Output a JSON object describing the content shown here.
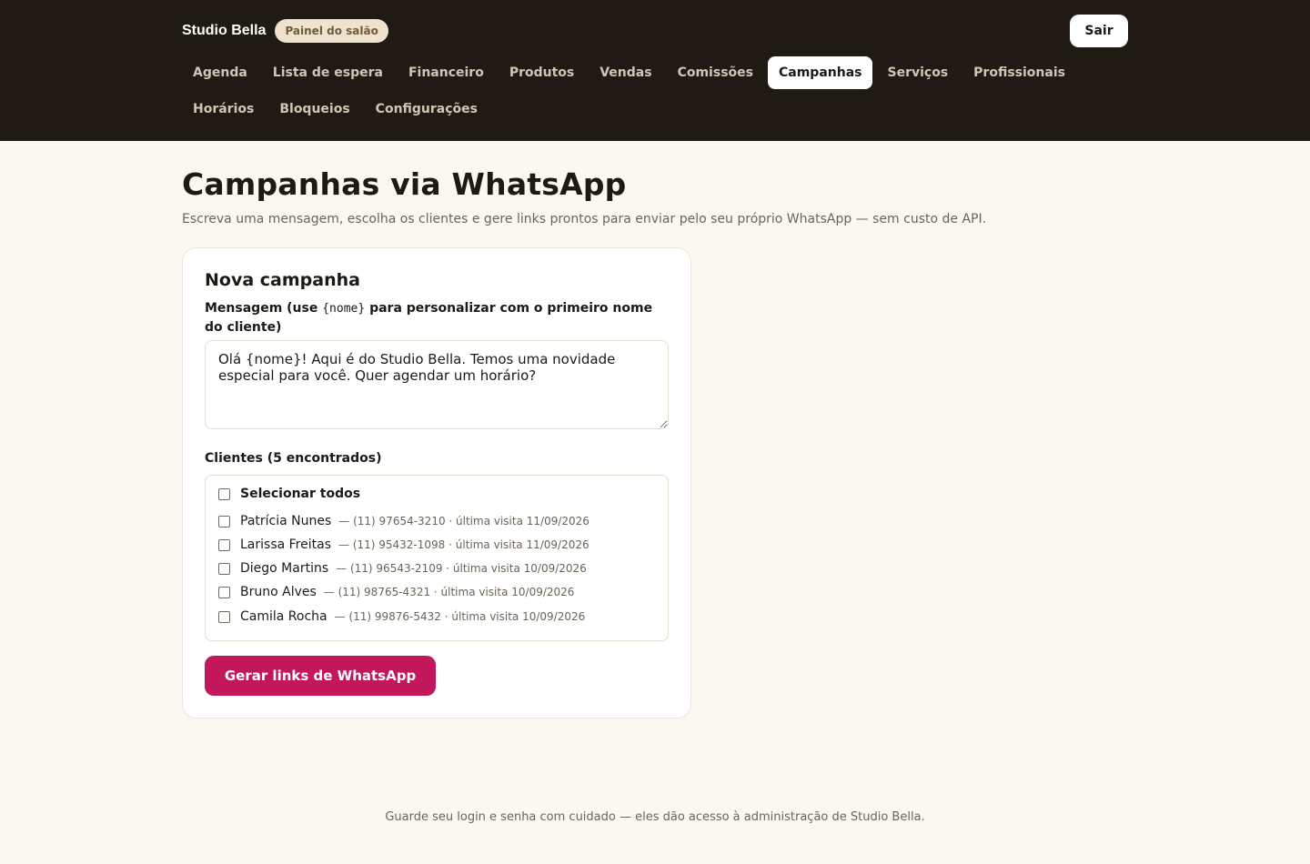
{
  "header": {
    "brand": "Studio Bella",
    "badge": "Painel do salão",
    "logout_label": "Sair",
    "nav": [
      {
        "label": "Agenda",
        "active": false
      },
      {
        "label": "Lista de espera",
        "active": false
      },
      {
        "label": "Financeiro",
        "active": false
      },
      {
        "label": "Produtos",
        "active": false
      },
      {
        "label": "Vendas",
        "active": false
      },
      {
        "label": "Comissões",
        "active": false
      },
      {
        "label": "Campanhas",
        "active": true
      },
      {
        "label": "Serviços",
        "active": false
      },
      {
        "label": "Profissionais",
        "active": false
      },
      {
        "label": "Horários",
        "active": false
      },
      {
        "label": "Bloqueios",
        "active": false
      },
      {
        "label": "Configurações",
        "active": false
      }
    ]
  },
  "main": {
    "title": "Campanhas via WhatsApp",
    "subtitle": "Escreva uma mensagem, escolha os clientes e gere links prontos para enviar pelo seu próprio WhatsApp — sem custo de API.",
    "card": {
      "title": "Nova campanha",
      "message_label_before": "Mensagem (use ",
      "message_label_code": "{nome}",
      "message_label_after": " para personalizar com o primeiro nome do cliente)",
      "message_value": "Olá {nome}! Aqui é do Studio Bella. Temos uma novidade especial para você. Quer agendar um horário?",
      "clients_label": "Clientes (5 encontrados)",
      "select_all_label": "Selecionar todos",
      "clients": [
        {
          "name": "Patrícia Nunes",
          "meta": "— (11) 97654-3210 · última visita 11/09/2026"
        },
        {
          "name": "Larissa Freitas",
          "meta": "— (11) 95432-1098 · última visita 11/09/2026"
        },
        {
          "name": "Diego Martins",
          "meta": "— (11) 96543-2109 · última visita 10/09/2026"
        },
        {
          "name": "Bruno Alves",
          "meta": "— (11) 98765-4321 · última visita 10/09/2026"
        },
        {
          "name": "Camila Rocha",
          "meta": "— (11) 99876-5432 · última visita 10/09/2026"
        }
      ],
      "generate_label": "Gerar links de WhatsApp"
    }
  },
  "footer": {
    "text": "Guarde seu login e senha com cuidado — eles dão acesso à administração de Studio Bella."
  },
  "colors": {
    "header_bg": "#1f1b14",
    "page_bg": "#fbf8f2",
    "accent": "#c2185b",
    "badge_bg": "#efe3cf"
  }
}
